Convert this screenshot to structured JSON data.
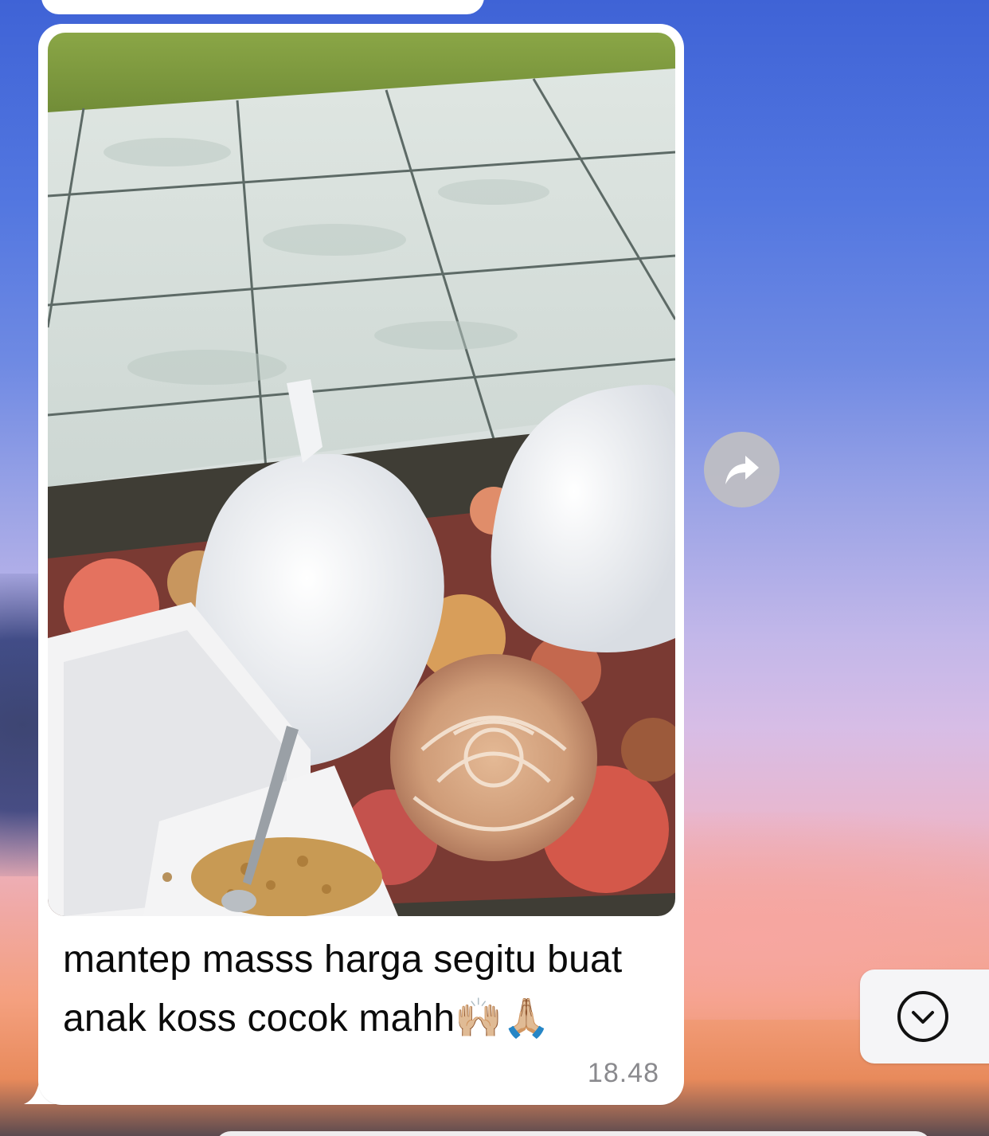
{
  "message": {
    "caption_line1": "mantep masss harga segitu buat",
    "caption_line2": "anak koss cocok mahh🙌🏼🙏🏼",
    "time": "18.48",
    "photo_alt": "photo"
  },
  "controls": {
    "forward_icon": "forward-arrow-icon",
    "scroll_down_icon": "chevron-down-circle-icon"
  },
  "colors": {
    "bubble": "#ffffff",
    "time_text": "#8a8a8e",
    "forward_button": "#bebec3"
  }
}
